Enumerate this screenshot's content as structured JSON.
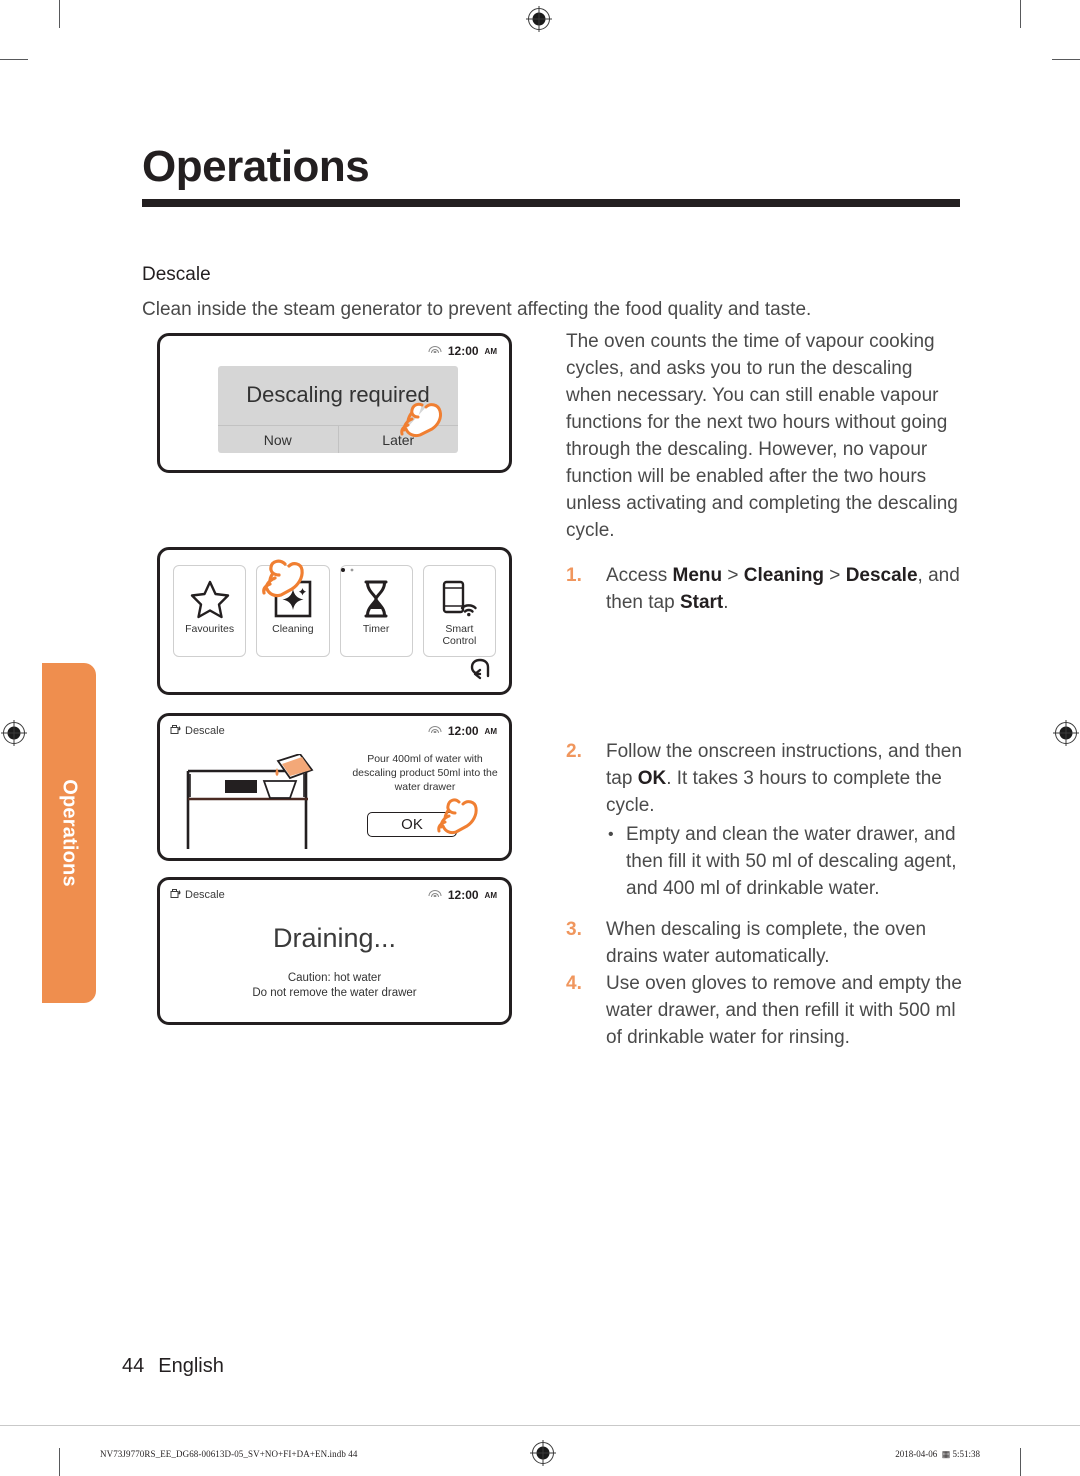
{
  "chapter": {
    "title": "Operations",
    "side_tab_label": "Operations"
  },
  "section": {
    "heading": "Descale",
    "intro": "Clean inside the steam generator to prevent affecting the food quality and taste."
  },
  "right_column": {
    "paragraph": "The oven counts the time of vapour cooking cycles, and asks you to run the descaling when necessary. You can still enable vapour functions for the next two hours without going through the descaling. However, no vapour function will be enabled after the two hours unless activating and completing the descaling cycle.",
    "steps": [
      {
        "num": "1.",
        "part1": "Access ",
        "b1": "Menu",
        "sep1": " > ",
        "b2": "Cleaning",
        "sep2": " > ",
        "b3": "Descale",
        "part2": ", and then tap ",
        "b4": "Start",
        "part3": "."
      },
      {
        "num": "2.",
        "part1": "Follow the onscreen instructions, and then tap ",
        "b1": "OK",
        "part2": ". It takes 3 hours to complete the cycle.",
        "bullets": [
          "Empty and clean the water drawer, and then fill it with 50 ml of descaling agent, and 400 ml of drinkable water."
        ]
      },
      {
        "num": "3.",
        "part1": "When descaling is complete, the oven drains water automatically."
      },
      {
        "num": "4.",
        "part1": "Use oven gloves to remove and empty the water drawer, and then refill it with 500 ml of drinkable water for rinsing."
      }
    ]
  },
  "screens": [
    {
      "id": "screen1",
      "status_clock": "12:00",
      "status_ampm": "AM",
      "dialog_message": "Descaling required",
      "button_now": "Now",
      "button_later": "Later"
    },
    {
      "id": "screen2",
      "tiles": [
        {
          "icon": "star-icon",
          "label": "Favourites"
        },
        {
          "icon": "sparkle-cleaning-icon",
          "label": "Cleaning"
        },
        {
          "icon": "hourglass-timer-icon",
          "label": "Timer"
        },
        {
          "icon": "smart-control-icon",
          "label": "Smart\nControl"
        }
      ],
      "back_icon": "back-arrow-icon"
    },
    {
      "id": "screen3",
      "header_label": "Descale",
      "header_icon": "descale-icon",
      "status_clock": "12:00",
      "status_ampm": "AM",
      "instruction": "Pour 400ml of water with descaling product 50ml into the water drawer",
      "ok_button": "OK"
    },
    {
      "id": "screen4",
      "header_label": "Descale",
      "header_icon": "descale-icon",
      "status_clock": "12:00",
      "status_ampm": "AM",
      "title": "Draining...",
      "caution_line1": "Caution: hot water",
      "caution_line2": "Do not remove the water drawer"
    }
  ],
  "page_footer": {
    "page_number": "44",
    "language": "English",
    "print_file": "NV73J9770RS_EE_DG68-00613D-05_SV+NO+FI+DA+EN.indb   44",
    "print_date": "2018-04-06",
    "print_time": "5:51:38"
  },
  "colors": {
    "accent_orange": "#ef8e4e",
    "step_number_orange": "#f0965d",
    "ink": "#231f20",
    "body_text": "#4a4a4a",
    "dialog_grey": "#d6d6d6"
  }
}
